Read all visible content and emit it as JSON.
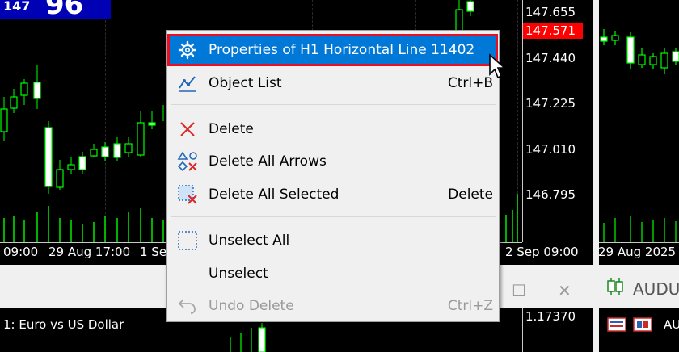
{
  "main_chart": {
    "symbol_bid_small": "147",
    "symbol_bid_big": "96",
    "price_labels": [
      "147.655",
      "147.440",
      "147.225",
      "147.010",
      "146.795"
    ],
    "ask_price": "147.571",
    "time_labels": [
      "09:00",
      "29 Aug 17:00",
      "1 Se",
      "2 Sep 09:00"
    ]
  },
  "right_chart": {
    "time_label": "29 Aug 2025"
  },
  "bottom_window": {
    "title": "1:  Euro vs US Dollar",
    "price_label": "1.17370",
    "maximize_glyph": "☐",
    "close_glyph": "✕",
    "right_tab_label": "AUDU",
    "right_tab_suffix": "AU"
  },
  "context_menu": {
    "items": [
      {
        "label": "Properties of H1 Horizontal Line 11402",
        "shortcut": "",
        "icon": "gear-icon",
        "state": "highlighted"
      },
      {
        "label": "Object List",
        "shortcut": "Ctrl+B",
        "icon": "object-list-icon",
        "state": "enabled"
      },
      {
        "label": "Delete",
        "shortcut": "",
        "icon": "delete-x-icon",
        "state": "enabled"
      },
      {
        "label": "Delete All Arrows",
        "shortcut": "",
        "icon": "delete-arrows-icon",
        "state": "enabled"
      },
      {
        "label": "Delete All Selected",
        "shortcut": "Delete",
        "icon": "delete-selected-icon",
        "state": "enabled"
      },
      {
        "label": "Unselect All",
        "shortcut": "",
        "icon": "unselect-all-icon",
        "state": "enabled"
      },
      {
        "label": "Unselect",
        "shortcut": "",
        "icon": "",
        "state": "enabled"
      },
      {
        "label": "Undo Delete",
        "shortcut": "Ctrl+Z",
        "icon": "undo-icon",
        "state": "disabled"
      }
    ]
  },
  "colors": {
    "highlight": "#0078d7",
    "highlight_border": "#e81123",
    "bull_candle": "#00ff00",
    "ask_tag": "#ff0000",
    "symbol_box": "#0000b4"
  }
}
